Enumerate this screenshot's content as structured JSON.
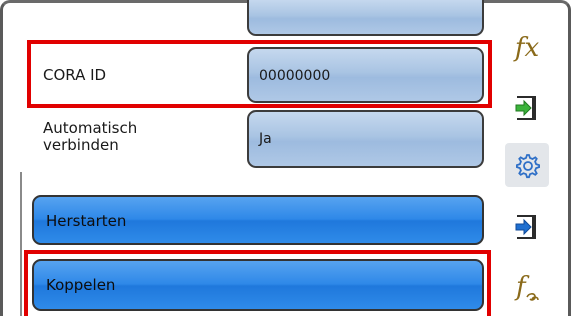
{
  "settings": {
    "cora_id": {
      "label": "CORA ID",
      "value": "00000000"
    },
    "auto_connect": {
      "label_line1": "Automatisch",
      "label_line2": "verbinden",
      "value": "Ja"
    }
  },
  "actions": {
    "restart_label": "Herstarten",
    "pair_label": "Koppelen"
  },
  "sidebar": {
    "function_icon_text": "fx",
    "link_function_icon_text": "f"
  },
  "colors": {
    "highlight": "#e10000",
    "button_blue": "#2e88e8",
    "field_blue": "#a9c4e3",
    "import_arrow_green": "#3cb43c",
    "export_arrow_blue": "#1f6fd0",
    "function_icon": "#8a6a1a"
  },
  "icons": [
    "function-icon",
    "import-icon",
    "settings-gear-icon",
    "export-icon",
    "function-link-icon"
  ]
}
